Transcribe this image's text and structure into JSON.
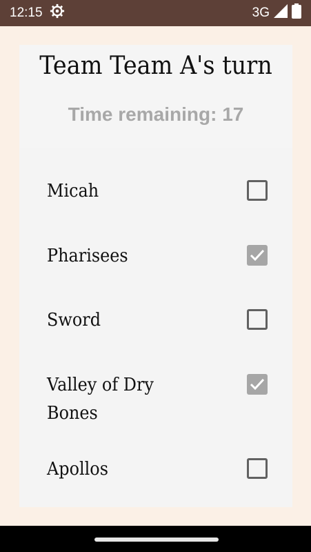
{
  "status_bar": {
    "time": "12:15",
    "network": "3G",
    "settings_icon": "gear-icon",
    "signal_icon": "signal-icon",
    "battery_icon": "battery-icon"
  },
  "game": {
    "turn_title": "Team Team A's turn",
    "timer_text": "Time remaining: 17"
  },
  "words": [
    {
      "label": "Micah",
      "checked": false
    },
    {
      "label": "Pharisees",
      "checked": true
    },
    {
      "label": "Sword",
      "checked": false
    },
    {
      "label": "Valley of Dry Bones",
      "checked": true
    },
    {
      "label": "Apollos",
      "checked": false
    }
  ],
  "colors": {
    "status_bar": "#5d4037",
    "background": "#fbf0e6",
    "card": "#f5f5f5",
    "checked_box": "#a6a6a6",
    "unchecked_border": "#616161"
  }
}
